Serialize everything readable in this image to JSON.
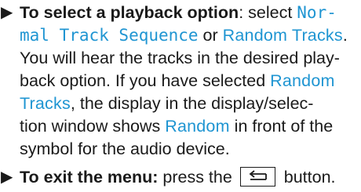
{
  "steps": [
    {
      "bullet": "▶",
      "lines": [
        {
          "bold": "To select a playback option",
          "t1": ": select ",
          "h1": "Nor-"
        },
        {
          "h1": "mal Track Sequence",
          "t1": " or ",
          "h2": "Random Tracks",
          "t2": "."
        },
        {
          "t1": "You will hear the tracks in the desired play-"
        },
        {
          "t1": "back option. If you have selected ",
          "h1": "Random"
        },
        {
          "h1": "Tracks",
          "t1": ", the display in the display/selec-"
        },
        {
          "t1": "tion window shows ",
          "h1": "Random",
          "t2": " in front of the"
        },
        {
          "t1": "symbol for the audio device."
        }
      ]
    },
    {
      "bullet": "▶",
      "lines": [
        {
          "bold": "To exit the menu:",
          "t1": " press the ",
          "icon": "back-arrow-icon",
          "t2": " button."
        }
      ]
    }
  ],
  "colors": {
    "highlight": "#1f95d2",
    "text": "#1a1a1a"
  }
}
